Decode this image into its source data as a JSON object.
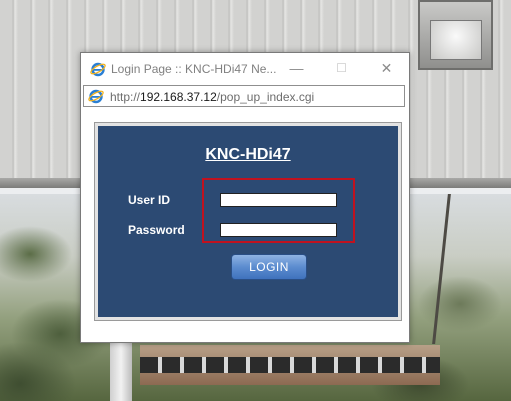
{
  "window": {
    "title": "Login Page :: KNC-HDi47 Ne...",
    "controls": {
      "minimize": "—",
      "maximize": "☐",
      "close": "✕"
    }
  },
  "address_bar": {
    "prefix": "http://",
    "host": "192.168.37.12",
    "path": "/pop_up_index.cgi"
  },
  "login": {
    "title": "KNC-HDi47",
    "user_id_label": "User ID",
    "password_label": "Password",
    "user_id_value": "",
    "password_value": "",
    "button_label": "LOGIN"
  },
  "colors": {
    "panel": "#2c4a73",
    "highlight": "#c0121f",
    "button": "#5c8ccf"
  },
  "icons": [
    "ie-icon"
  ]
}
